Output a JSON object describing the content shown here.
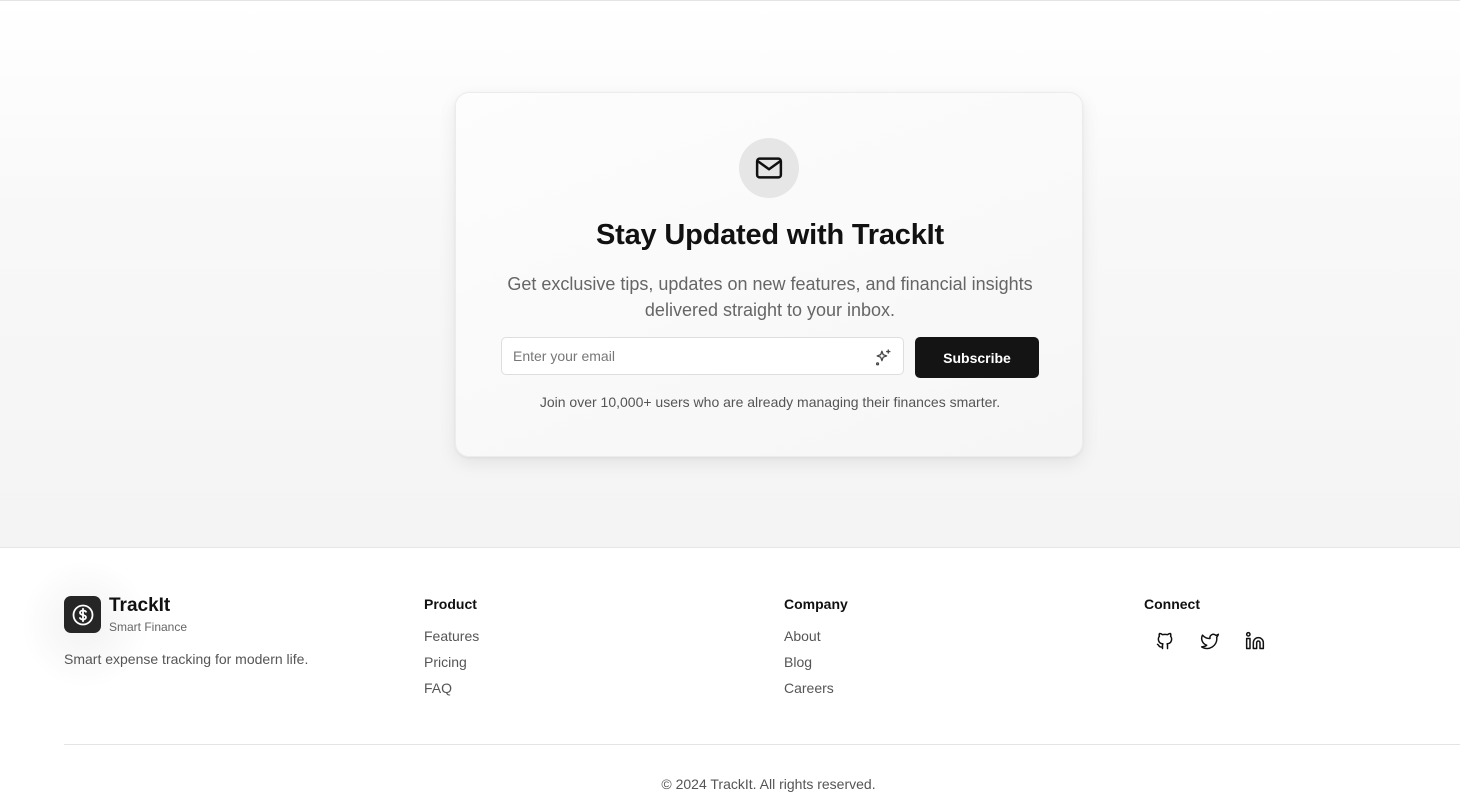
{
  "newsletter": {
    "title": "Stay Updated with TrackIt",
    "description": "Get exclusive tips, updates on new features, and financial insights delivered straight to your inbox.",
    "email_placeholder": "Enter your email",
    "email_value": "",
    "subscribe_label": "Subscribe",
    "note": "Join over 10,000+ users who are already managing their finances smarter.",
    "icon": "mail-icon"
  },
  "footer": {
    "brand": {
      "name": "TrackIt",
      "tagline": "Smart Finance",
      "description": "Smart expense tracking for modern life.",
      "logo_icon": "dollar-circle-icon"
    },
    "columns": [
      {
        "title": "Product",
        "links": [
          "Features",
          "Pricing",
          "FAQ"
        ]
      },
      {
        "title": "Company",
        "links": [
          "About",
          "Blog",
          "Careers"
        ]
      }
    ],
    "connect": {
      "title": "Connect",
      "icons": [
        "github-icon",
        "twitter-icon",
        "linkedin-icon"
      ]
    },
    "copyright": "© 2024 TrackIt. All rights reserved."
  },
  "colors": {
    "primary_button": "#141414",
    "text_muted": "#666666",
    "card_background": "#f8f8f8"
  }
}
